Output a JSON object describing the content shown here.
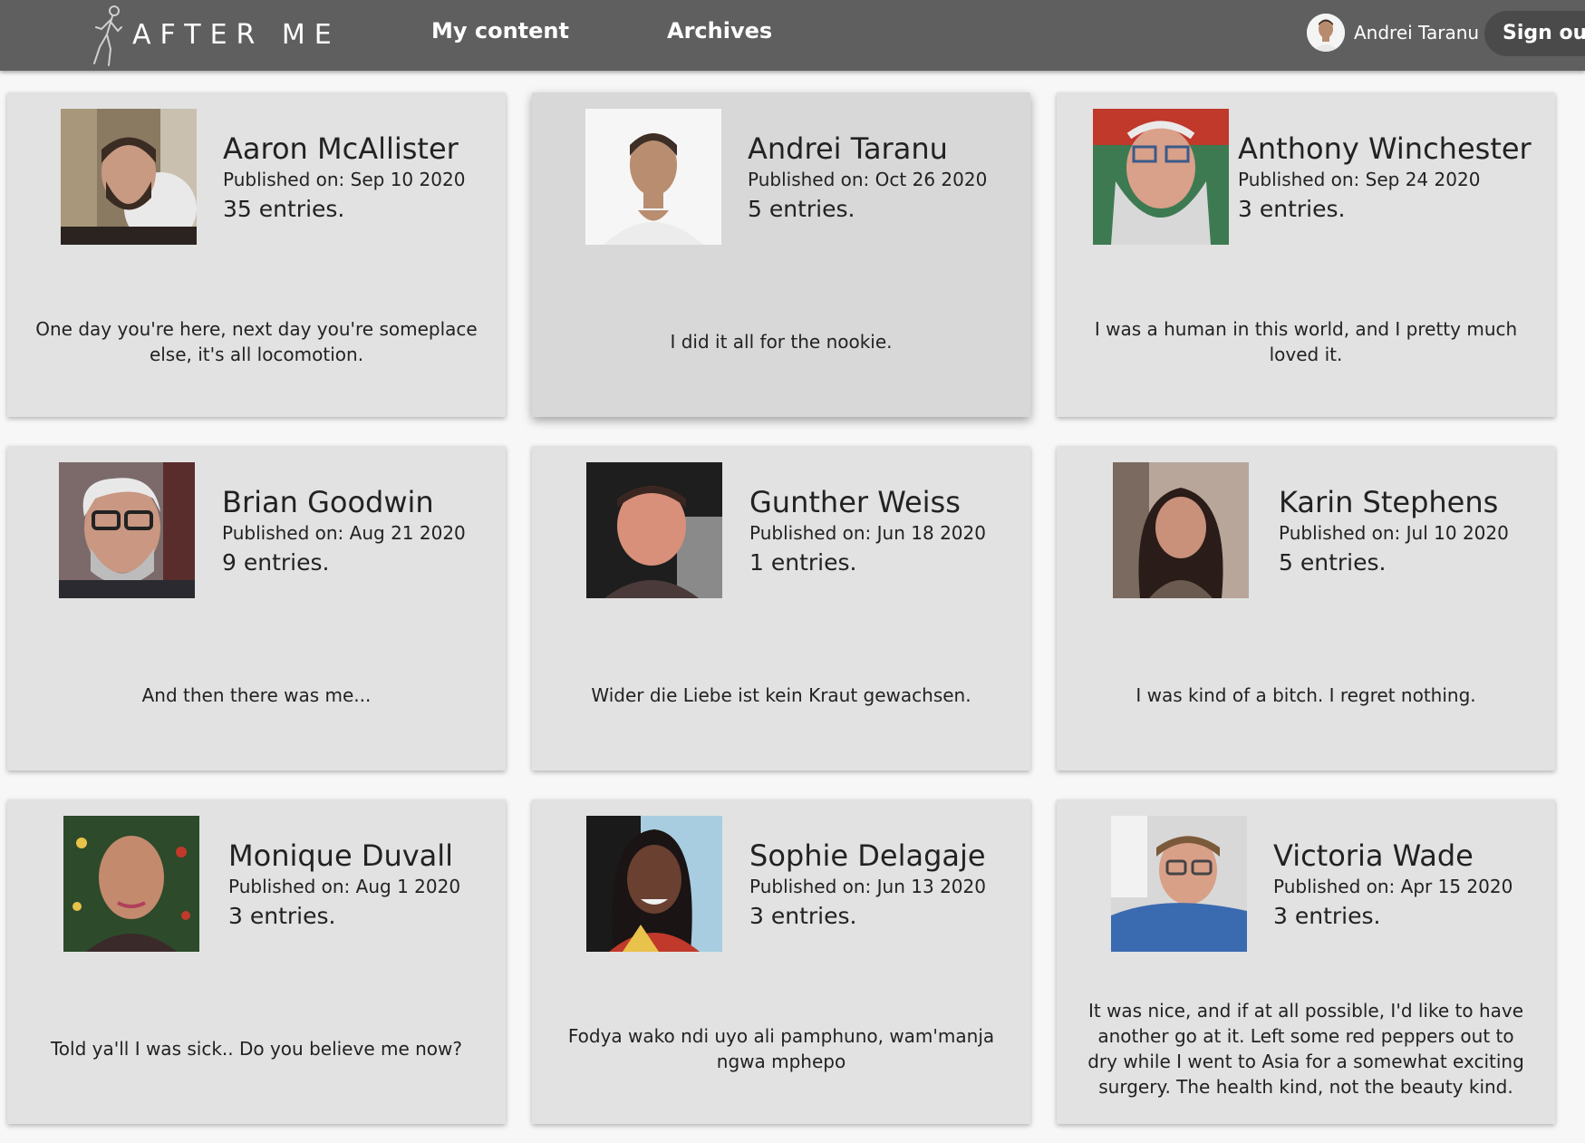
{
  "header": {
    "logo_text": "AFTER ME",
    "nav": [
      {
        "label": "My content"
      },
      {
        "label": "Archives"
      }
    ],
    "user_name": "Andrei Taranu",
    "sign_out_label": "Sign out"
  },
  "published_prefix": "Published on: ",
  "profiles": [
    {
      "name": "Aaron McAllister",
      "published": "Published on: Sep 10 2020",
      "entries": "35 entries.",
      "quote": "One day you're here, next day you're someplace else, it's all locomotion."
    },
    {
      "name": "Andrei Taranu",
      "published": "Published on: Oct 26 2020",
      "entries": "5 entries.",
      "quote": "I did it all for the nookie."
    },
    {
      "name": "Anthony Winchester",
      "published": "Published on: Sep 24 2020",
      "entries": "3 entries.",
      "quote": "I was a human in this world, and I pretty much loved it."
    },
    {
      "name": "Brian Goodwin",
      "published": "Published on: Aug 21 2020",
      "entries": "9 entries.",
      "quote": "And then there was me..."
    },
    {
      "name": "Gunther Weiss",
      "published": "Published on: Jun 18 2020",
      "entries": "1 entries.",
      "quote": "Wider die Liebe ist kein Kraut gewachsen."
    },
    {
      "name": "Karin Stephens",
      "published": "Published on: Jul 10 2020",
      "entries": "5 entries.",
      "quote": "I was kind of a bitch. I regret nothing."
    },
    {
      "name": "Monique Duvall",
      "published": "Published on: Aug 1 2020",
      "entries": "3 entries.",
      "quote": "Told ya'll I was sick.. Do you believe me now?"
    },
    {
      "name": "Sophie Delagaje",
      "published": "Published on: Jun 13 2020",
      "entries": "3 entries.",
      "quote": "Fodya wako ndi uyo ali pamphuno, wam'manja ngwa mphepo"
    },
    {
      "name": "Victoria Wade",
      "published": "Published on: Apr 15 2020",
      "entries": "3 entries.",
      "quote": "It was nice, and if at all possible, I'd like to have another go at it. Left some red peppers out to dry while I went to Asia for a somewhat exciting surgery. The health kind, not the beauty kind."
    }
  ],
  "colors": {
    "header_bg": "#5f5f5f",
    "card_bg": "#e2e2e2",
    "card_hover_bg": "#d8d8d8",
    "page_bg": "#f7f7f7"
  }
}
